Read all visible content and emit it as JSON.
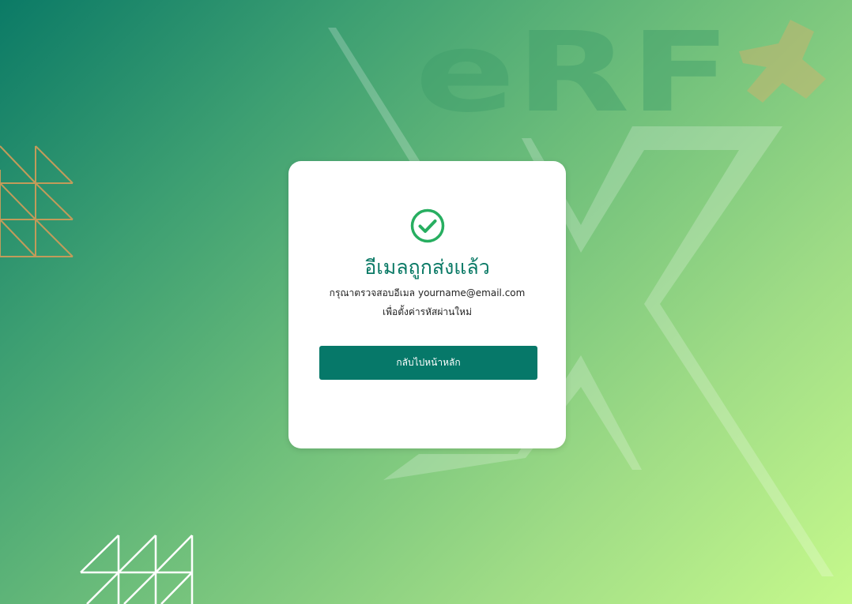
{
  "background": {
    "logo_text": "eRF",
    "colors": {
      "gradient_start": "#0b7a66",
      "gradient_end": "#c6f98c"
    }
  },
  "card": {
    "icon": "check-circle-icon",
    "title": "อีเมลถูกส่งแล้ว",
    "message_line1": "กรุณาตรวจสอบอีเมล",
    "email": "yourname@email.com",
    "message_line2": "เพื่อตั้งค่ารหัสผ่านใหม่",
    "button_label": "กลับไปหน้าหลัก",
    "colors": {
      "accent": "#0b7a66",
      "icon": "#27ae60",
      "button": "#067869"
    }
  }
}
